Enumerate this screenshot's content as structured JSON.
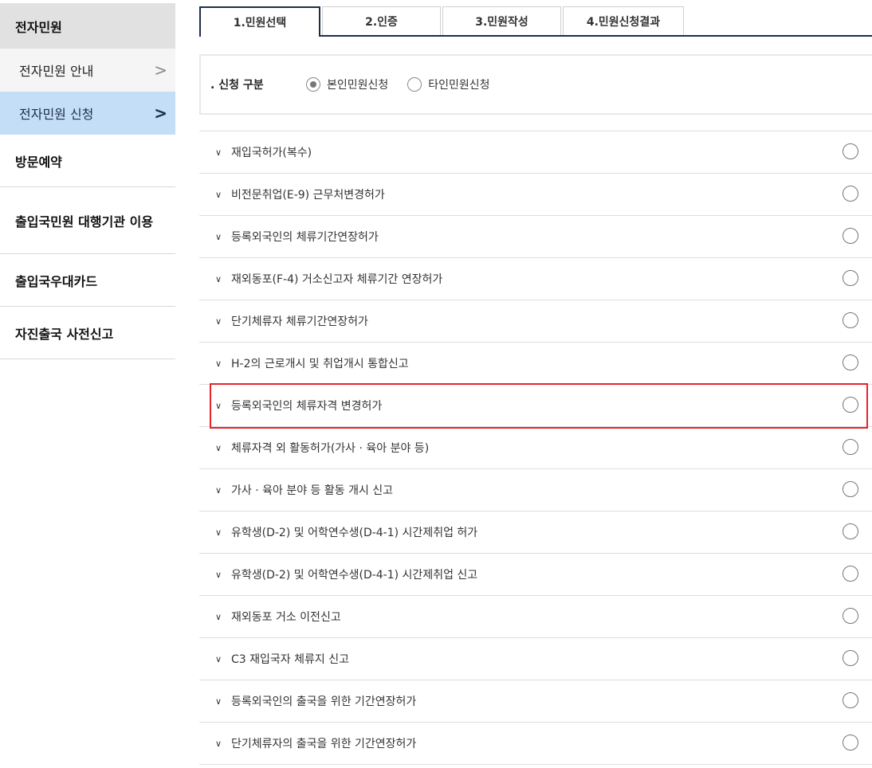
{
  "sidebar": {
    "header": "전자민원",
    "sub_items": [
      {
        "label": "전자민원 안내",
        "chevron": ">"
      },
      {
        "label": "전자민원 신청",
        "chevron": ">"
      }
    ],
    "items": [
      {
        "label": "방문예약"
      },
      {
        "label": "출입국민원 대행기관 이용"
      },
      {
        "label": "출입국우대카드"
      },
      {
        "label": "자진출국 사전신고"
      }
    ]
  },
  "tabs": [
    {
      "label": "1.민원선택"
    },
    {
      "label": "2.인증"
    },
    {
      "label": "3.민원작성"
    },
    {
      "label": "4.민원신청결과"
    }
  ],
  "request_type": {
    "label": ". 신청 구분",
    "options": [
      {
        "label": "본인민원신청"
      },
      {
        "label": "타인민원신청"
      }
    ]
  },
  "list": [
    {
      "label": "재입국허가(복수)"
    },
    {
      "label": "비전문취업(E-9) 근무처변경허가"
    },
    {
      "label": "등록외국인의 체류기간연장허가"
    },
    {
      "label": "재외동포(F-4) 거소신고자 체류기간 연장허가"
    },
    {
      "label": "단기체류자 체류기간연장허가"
    },
    {
      "label": "H-2의 근로개시 및 취업개시 통합신고"
    },
    {
      "label": "등록외국인의 체류자격 변경허가"
    },
    {
      "label": "체류자격 외 활동허가(가사 · 육아 분야 등)"
    },
    {
      "label": "가사 · 육아 분야 등 활동 개시 신고"
    },
    {
      "label": "유학생(D-2) 및 어학연수생(D-4-1) 시간제취업 허가"
    },
    {
      "label": "유학생(D-2) 및 어학연수생(D-4-1) 시간제취업 신고"
    },
    {
      "label": "재외동포 거소 이전신고"
    },
    {
      "label": "C3 재입국자 체류지 신고"
    },
    {
      "label": "등록외국인의 출국을 위한 기간연장허가"
    },
    {
      "label": "단기체류자의 출국을 위한 기간연장허가"
    }
  ],
  "colors": {
    "accent": "#1c2e4a",
    "active_bg": "#c5def7",
    "highlight": "#e8222a"
  }
}
